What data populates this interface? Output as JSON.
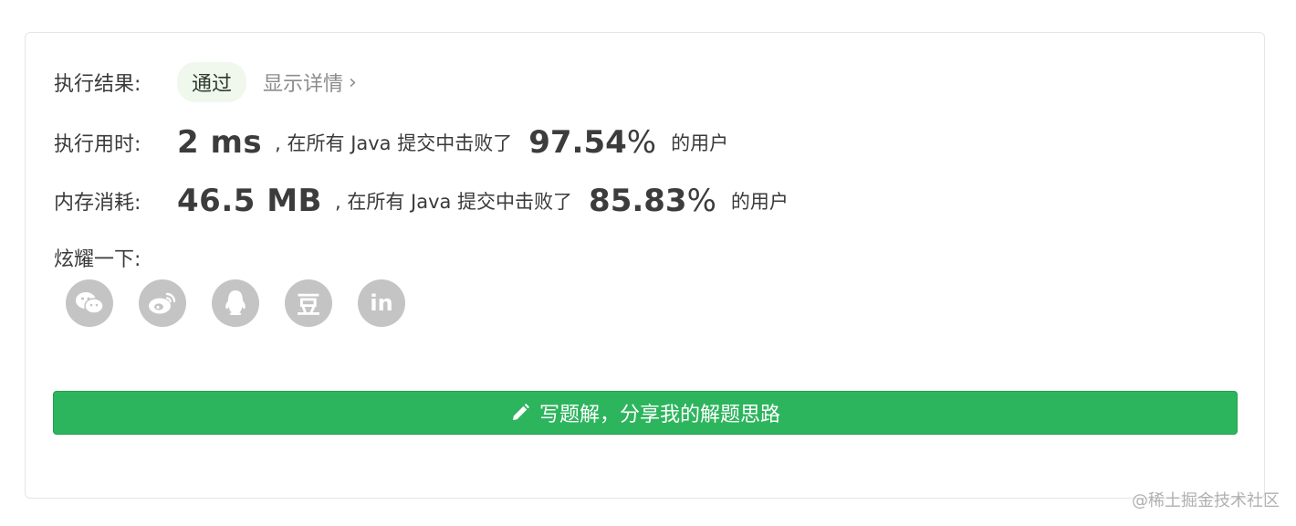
{
  "result": {
    "label": "执行结果:",
    "status": "通过",
    "details_link": "显示详情",
    "chevron": "›"
  },
  "runtime": {
    "label": "执行用时:",
    "value": "2 ms",
    "beat_prefix": ", 在所有 Java 提交中击败了",
    "percent": "97.54",
    "percent_sign": "%",
    "suffix": "的用户"
  },
  "memory": {
    "label": "内存消耗:",
    "value": "46.5 MB",
    "beat_prefix": ", 在所有 Java 提交中击败了",
    "percent": "85.83",
    "percent_sign": "%",
    "suffix": "的用户"
  },
  "share": {
    "label": "炫耀一下:",
    "icons": [
      "wechat-icon",
      "weibo-icon",
      "qq-icon",
      "douban-icon",
      "linkedin-icon"
    ],
    "douban_glyph": "豆",
    "linkedin_glyph": "in"
  },
  "write_button": {
    "label": "写题解，分享我的解题思路",
    "icon": "pencil-icon"
  },
  "watermark": "@稀土掘金技术社区",
  "colors": {
    "accent_green": "#2db55d",
    "badge_bg": "#f0f8ee",
    "icon_gray": "#c4c4c4"
  }
}
